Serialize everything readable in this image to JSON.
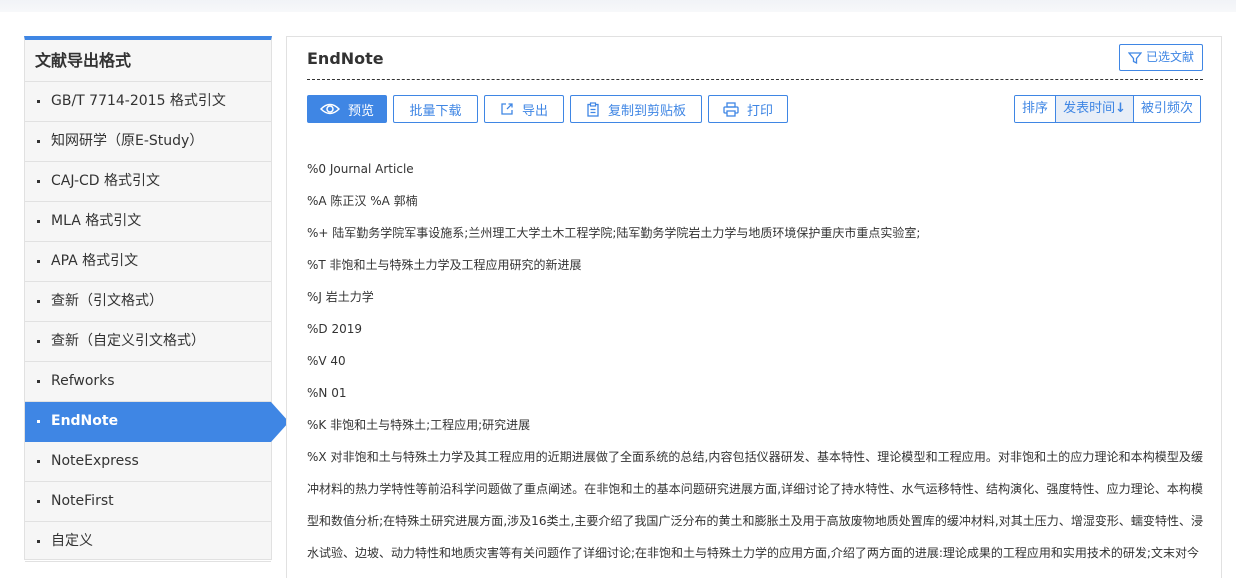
{
  "sidebar": {
    "title": "文献导出格式",
    "items": [
      {
        "label": "GB/T 7714-2015 格式引文"
      },
      {
        "label": "知网研学（原E-Study）"
      },
      {
        "label": "CAJ-CD 格式引文"
      },
      {
        "label": "MLA 格式引文"
      },
      {
        "label": "APA 格式引文"
      },
      {
        "label": "查新（引文格式）"
      },
      {
        "label": "查新（自定义引文格式）"
      },
      {
        "label": "Refworks"
      },
      {
        "label": "EndNote"
      },
      {
        "label": "NoteExpress"
      },
      {
        "label": "NoteFirst"
      },
      {
        "label": "自定义"
      }
    ],
    "active_index": 8
  },
  "main": {
    "title": "EndNote",
    "selected_docs_label": "已选文献",
    "toolbar": {
      "preview": "预览",
      "batch_download": "批量下载",
      "export": "导出",
      "copy_clipboard": "复制到剪贴板",
      "print": "打印"
    },
    "sort": {
      "label": "排序",
      "pub_time": "发表时间",
      "cited": "被引频次"
    },
    "record": {
      "type": "%0 Journal Article",
      "authors": "%A 陈正汉 %A 郭楠",
      "affiliations": "%+ 陆军勤务学院军事设施系;兰州理工大学土木工程学院;陆军勤务学院岩土力学与地质环境保护重庆市重点实验室;",
      "title": "%T 非饱和土与特殊土力学及工程应用研究的新进展",
      "journal": "%J 岩土力学",
      "date": "%D 2019",
      "volume": "%V 40",
      "number": "%N 01",
      "keywords": "%K 非饱和土与特殊土;工程应用;研究进展",
      "abstract": "%X 对非饱和土与特殊土力学及其工程应用的近期进展做了全面系统的总结,内容包括仪器研发、基本特性、理论模型和工程应用。对非饱和土的应力理论和本构模型及缓冲材料的热力学特性等前沿科学问题做了重点阐述。在非饱和土的基本问题研究进展方面,详细讨论了持水特性、水气运移特性、结构演化、强度特性、应力理论、本构模型和数值分析;在特殊土研究进展方面,涉及16类土,主要介绍了我国广泛分布的黄土和膨胀土及用于高放废物地质处置库的缓冲材料,对其土压力、增湿变形、蠕变特性、浸水试验、边坡、动力特性和地质灾害等有关问题作了详细讨论;在非饱和土与特殊土力学的应用方面,介绍了两方面的进展:理论成果的工程应用和实用技术的研发;文末对今"
    }
  },
  "colors": {
    "accent": "#3f86e4",
    "sidebar_bg": "#f6f6f6"
  }
}
